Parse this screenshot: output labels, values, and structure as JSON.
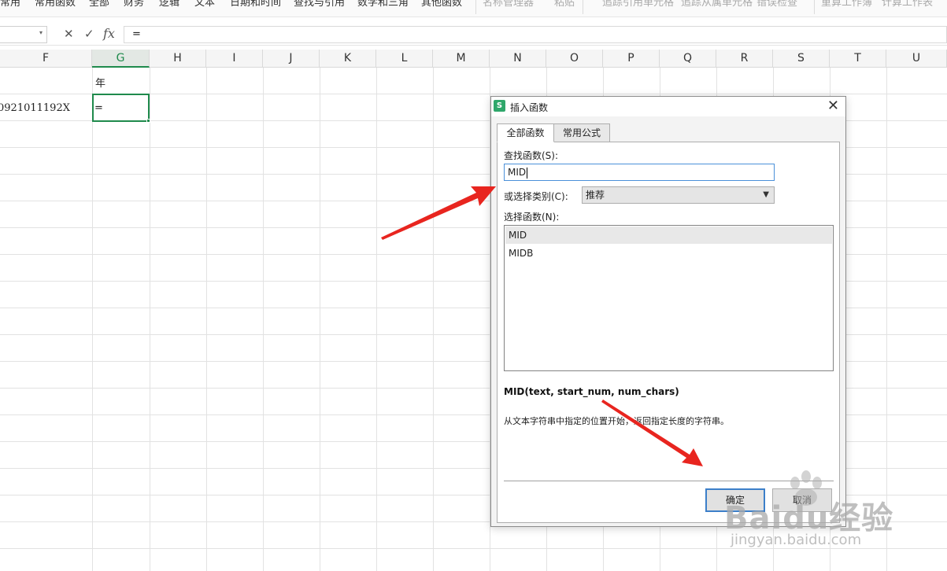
{
  "ribbon": {
    "items": [
      "常用",
      "常用函数",
      "全部",
      "财务",
      "逻辑",
      "文本",
      "日期和时间",
      "查找与引用",
      "数学和三角",
      "其他函数",
      "名称管理器",
      "粘贴",
      "追踪引用单元格",
      "追踪从属单元格",
      "错误检查",
      "重算工作簿",
      "计算工作表"
    ]
  },
  "formula_bar": {
    "name_box": "",
    "cancel_icon": "✕",
    "confirm_icon": "✓",
    "fx_label": "fx",
    "formula": "="
  },
  "sheet": {
    "columns": [
      "F",
      "G",
      "H",
      "I",
      "J",
      "K",
      "L",
      "M",
      "N",
      "O",
      "P",
      "Q",
      "R",
      "S",
      "T",
      "U"
    ],
    "selected_column": "G",
    "cells": {
      "g1": "年",
      "f2": "0921011192X",
      "g2": "="
    }
  },
  "dialog": {
    "logo": "S",
    "title": "插入函数",
    "close_icon": "✕",
    "tabs": [
      "全部函数",
      "常用公式"
    ],
    "search_label": "查找函数(S):",
    "search_value": "MID",
    "category_label": "或选择类别(C):",
    "category_value": "推荐",
    "function_list_label": "选择函数(N):",
    "functions": [
      "MID",
      "MIDB"
    ],
    "selected_function": "MID",
    "signature": "MID(text, start_num, num_chars)",
    "description": "从文本字符串中指定的位置开始，返回指定长度的字符串。",
    "ok_label": "确定",
    "cancel_label": "取消"
  },
  "watermark": {
    "brand": "Baidu经验",
    "url": "jingyan.baidu.com"
  },
  "colors": {
    "accent_green": "#1f8a4c",
    "arrow_red": "#e8251f",
    "dialog_focus_blue": "#3c7fc9"
  }
}
